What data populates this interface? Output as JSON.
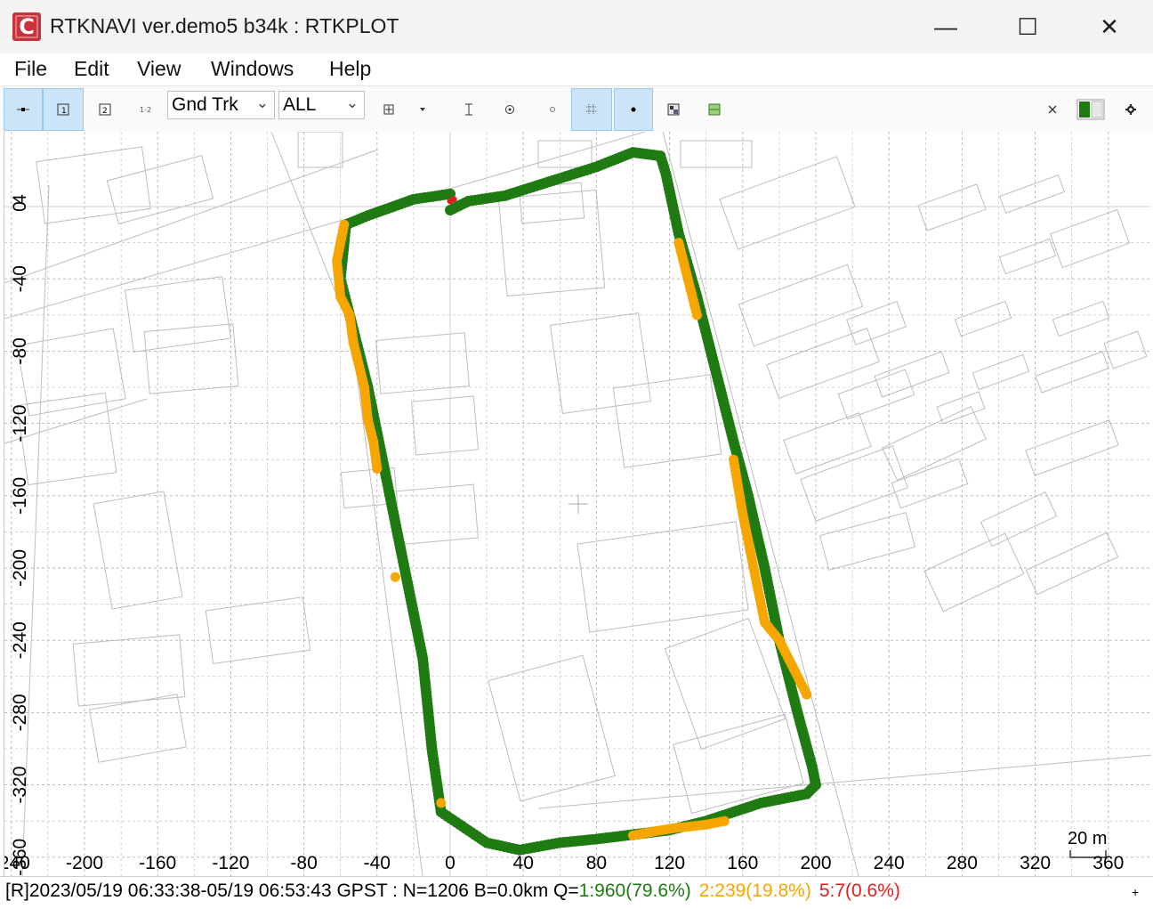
{
  "window": {
    "title": "RTKNAVI ver.demo5 b34k : RTKPLOT",
    "icon": "app-logo-icon",
    "controls": {
      "minimize": "—",
      "maximize": "☐",
      "close": "✕"
    }
  },
  "menu": [
    "File",
    "Edit",
    "View",
    "Windows",
    "Help"
  ],
  "toolbar": {
    "plot_type": "Gnd Trk",
    "sat_filter": "ALL",
    "buttons": [
      "solution-0-icon",
      "solution-1-icon",
      "solution-2-icon",
      "solution-1-2-icon",
      "center-origin-icon",
      "dropdown-arrow-icon",
      "fit-vertical-icon",
      "center-mark-icon",
      "dot-icon",
      "grid-icon",
      "point-icon",
      "map-image-icon",
      "map-layer-icon",
      "close-icon",
      "color-toggle-icon",
      "settings-icon"
    ]
  },
  "plot": {
    "y_ticks": [
      "4",
      "0",
      "-40",
      "-80",
      "-120",
      "-160",
      "-200",
      "-240",
      "-280",
      "-320",
      "-360"
    ],
    "x_ticks": [
      "-240",
      "-200",
      "-160",
      "-120",
      "-80",
      "-40",
      "0",
      "40",
      "80",
      "120",
      "160",
      "200",
      "240",
      "280",
      "320",
      "360"
    ],
    "scale_label": "20 m",
    "colors": {
      "fix": "#1f7a12",
      "float": "#f7a600",
      "single": "#e02020",
      "grid": "#b5b5b5",
      "map": "#bdbdbd"
    }
  },
  "chart_data": {
    "type": "scatter",
    "title": "",
    "xlabel": "",
    "ylabel": "",
    "xlim": [
      -245,
      365
    ],
    "ylim": [
      -365,
      8
    ],
    "grid": true,
    "series": [
      {
        "name": "1",
        "color": "#1f7a12",
        "points": [
          [
            0,
            -2
          ],
          [
            10,
            3
          ],
          [
            30,
            6
          ],
          [
            80,
            22
          ],
          [
            100,
            30
          ],
          [
            115,
            28
          ],
          [
            118,
            18
          ],
          [
            125,
            -15
          ],
          [
            135,
            -50
          ],
          [
            145,
            -90
          ],
          [
            155,
            -130
          ],
          [
            163,
            -160
          ],
          [
            172,
            -200
          ],
          [
            180,
            -240
          ],
          [
            190,
            -280
          ],
          [
            198,
            -310
          ],
          [
            200,
            -320
          ],
          [
            195,
            -325
          ],
          [
            170,
            -330
          ],
          [
            140,
            -340
          ],
          [
            120,
            -345
          ],
          [
            80,
            -350
          ],
          [
            60,
            -352
          ],
          [
            38,
            -356
          ],
          [
            20,
            -352
          ],
          [
            -5,
            -335
          ],
          [
            -10,
            -300
          ],
          [
            -15,
            -250
          ],
          [
            -25,
            -200
          ],
          [
            -35,
            -150
          ],
          [
            -45,
            -100
          ],
          [
            -55,
            -60
          ],
          [
            -60,
            -40
          ],
          [
            -57,
            -10
          ],
          [
            -45,
            -5
          ],
          [
            -20,
            4
          ],
          [
            0,
            7
          ]
        ]
      },
      {
        "name": "2",
        "color": "#f7a600",
        "points": [
          [
            -58,
            -10
          ],
          [
            -62,
            -30
          ],
          [
            -60,
            -50
          ],
          [
            -55,
            -60
          ],
          [
            -53,
            -75
          ],
          [
            -47,
            -100
          ],
          [
            -45,
            -118
          ],
          [
            -42,
            -130
          ],
          [
            -40,
            -145
          ],
          [
            -30,
            -205
          ],
          [
            125,
            -20
          ],
          [
            130,
            -40
          ],
          [
            135,
            -60
          ],
          [
            155,
            -140
          ],
          [
            160,
            -170
          ],
          [
            168,
            -210
          ],
          [
            172,
            -230
          ],
          [
            180,
            -240
          ],
          [
            195,
            -270
          ],
          [
            -5,
            -330
          ],
          [
            100,
            -348
          ],
          [
            110,
            -346
          ],
          [
            122,
            -344
          ],
          [
            140,
            -342
          ],
          [
            150,
            -340
          ],
          [
            200,
            -330
          ]
        ]
      },
      {
        "name": "5",
        "color": "#e02020",
        "points": [
          [
            0,
            3
          ],
          [
            2,
            4
          ]
        ]
      }
    ]
  },
  "status": {
    "prefix": "[R]2023/05/19 06:33:38-05/19 06:53:43 GPST : N=1206 B=0.0km Q=",
    "q1": "1:960(79.6%)",
    "q2": "2:239(19.8%)",
    "q5": "5:7(0.6%)",
    "right_icon": "+"
  }
}
